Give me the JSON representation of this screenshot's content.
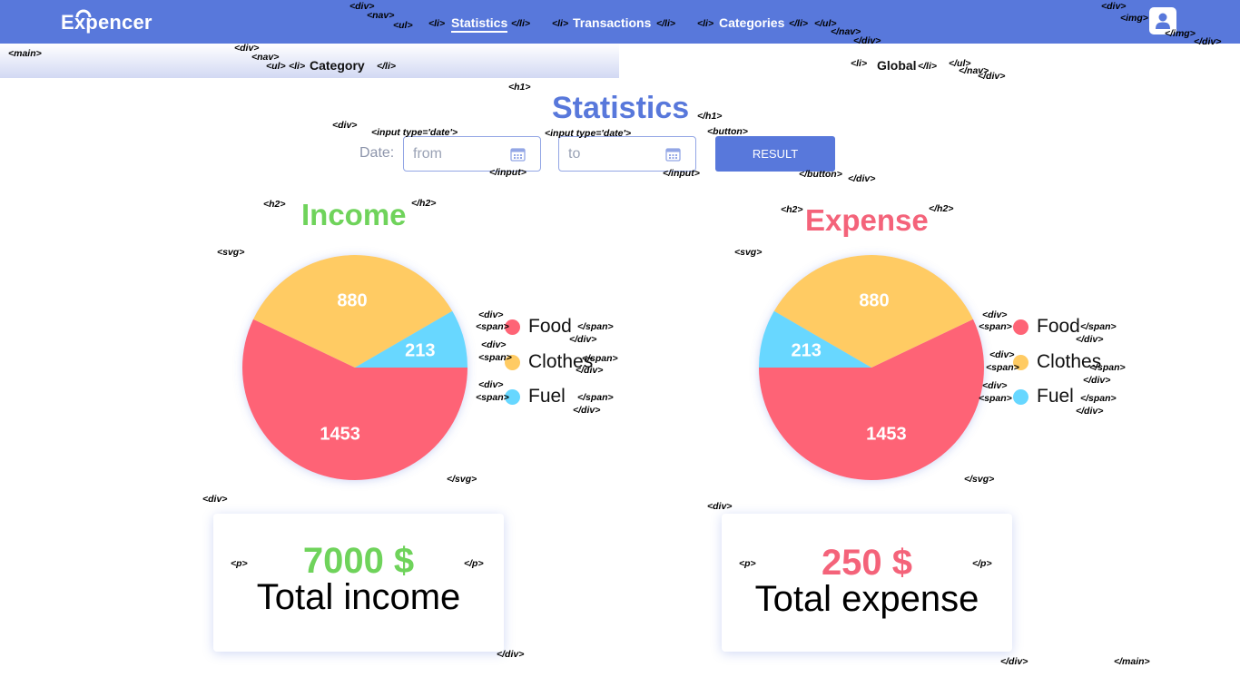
{
  "app": {
    "logo": "Expencer"
  },
  "nav": {
    "items": [
      {
        "label": "Statistics",
        "active": true
      },
      {
        "label": "Transactions",
        "active": false
      },
      {
        "label": "Categories",
        "active": false
      }
    ]
  },
  "subnav": {
    "left": "Category",
    "right": "Global"
  },
  "page": {
    "title": "Statistics"
  },
  "filter": {
    "label": "Date:",
    "from_placeholder": "from",
    "to_placeholder": "to",
    "button_label": "RESULT"
  },
  "colors": {
    "header": "#5878db",
    "income": "#6fd35b",
    "expense": "#f4637a",
    "food": "#fe6476",
    "clothes": "#ffcb63",
    "fuel": "#67d7ff"
  },
  "legend": [
    "Food",
    "Clothes",
    "Fuel"
  ],
  "income": {
    "title": "Income",
    "total": "7000 $",
    "total_label": "Total income"
  },
  "expense": {
    "title": "Expense",
    "total": "250 $",
    "total_label": "Total expense"
  },
  "chart_data": [
    {
      "type": "pie",
      "title": "Income",
      "categories": [
        "Food",
        "Clothes",
        "Fuel"
      ],
      "values": [
        1453,
        880,
        213
      ],
      "colors": [
        "#fe6476",
        "#ffcb63",
        "#67d7ff"
      ]
    },
    {
      "type": "pie",
      "title": "Expense",
      "categories": [
        "Food",
        "Clothes",
        "Fuel"
      ],
      "values": [
        1453,
        880,
        213
      ],
      "colors": [
        "#fe6476",
        "#ffcb63",
        "#67d7ff"
      ]
    }
  ],
  "markup_tags": [
    "<div>",
    "<nav>",
    "<ul>",
    "<li>",
    "</li>",
    "</li>",
    "</li>",
    "<li>",
    "<li>",
    "</ul>",
    "</nav>",
    "</div>",
    "<div>",
    "<img>",
    "</img>",
    "</div>",
    "<main>",
    "<div>",
    "<nav>",
    "<ul>",
    "<li>",
    "</li>",
    "<li>",
    "</li>",
    "</ul>",
    "</nav>",
    "</div>",
    "<h1>",
    "</h1>",
    "<div>",
    "<input type='date'>",
    "</input>",
    "<input type='date'>",
    "</input>",
    "<button>",
    "</button>",
    "</div>",
    "<h2>",
    "</h2>",
    "<svg>",
    "<div>",
    "<span>",
    "</span>",
    "</div>",
    "<div>",
    "<span>",
    "</span>",
    "</div>",
    "<div>",
    "<span>",
    "</span>",
    "</div>",
    "</svg>",
    "<h2>",
    "</h2>",
    "<svg>",
    "<div>",
    "<span>",
    "</span>",
    "</div>",
    "<div>",
    "<span>",
    "</span>",
    "</div>",
    "<div>",
    "<span>",
    "</span>",
    "</div>",
    "</svg>",
    "<div>",
    "<p>",
    "</p>",
    "</div>",
    "<div>",
    "<p>",
    "</p>",
    "</div>",
    "</main>"
  ]
}
